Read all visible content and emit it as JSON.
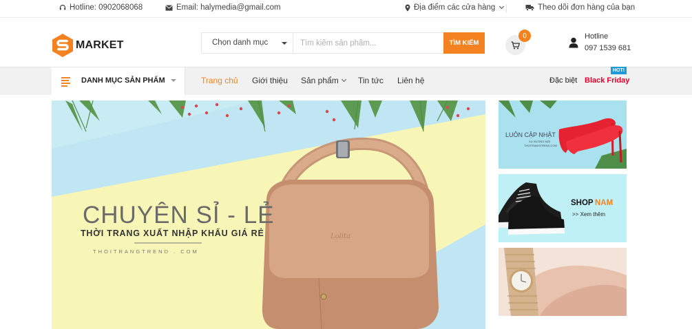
{
  "topbar": {
    "hotline": "Hotline: 0902068068",
    "email": "Email: halymedia@gmail.com",
    "stores": "Địa điểm các cửa hàng",
    "tracking": "Theo dõi đơn hàng của bạn"
  },
  "header": {
    "logo_text": "MARKET",
    "category_select": "Chọn danh mục",
    "search_placeholder": "Tìm kiếm sản phẩm...",
    "search_button": "TÌM KIẾM",
    "cart_count": "0",
    "hotline_label": "Hotline",
    "hotline_number": "097 1539 681"
  },
  "nav": {
    "category_menu": "DANH MỤC SẢN PHẨM",
    "links": [
      "Trang chủ",
      "Giới thiệu",
      "Sản phẩm",
      "Tin tức",
      "Liên hệ"
    ],
    "special": "Đặc biệt",
    "black_friday": "Black Friday",
    "hot_badge": "HOT!"
  },
  "banner": {
    "headline": "CHUYÊN SỈ - LẺ",
    "subline": "THỜI TRANG XUẤT NHẬP KHẨU GIÁ RẺ",
    "site": "THOITRANGTREND . COM",
    "bag_emboss": "Lolita"
  },
  "side_banners": {
    "one": {
      "title": "LUÔN CẬP NHẬT",
      "small1": "XU HƯỚNG MỚI",
      "small2": "THOITRANGTREND.COM"
    },
    "two": {
      "title_a": "SHOP",
      "title_b": "NAM",
      "link": ">> Xem thêm"
    }
  },
  "colors": {
    "accent": "#f58220",
    "black_friday": "#e4002b",
    "hot_badge": "#1f9bd8"
  },
  "icons": {
    "hotline": "headset-icon",
    "email": "envelope-icon",
    "stores": "map-marker-icon",
    "tracking": "truck-icon",
    "cart": "cart-icon",
    "user": "user-icon",
    "menu": "hamburger-icon"
  }
}
